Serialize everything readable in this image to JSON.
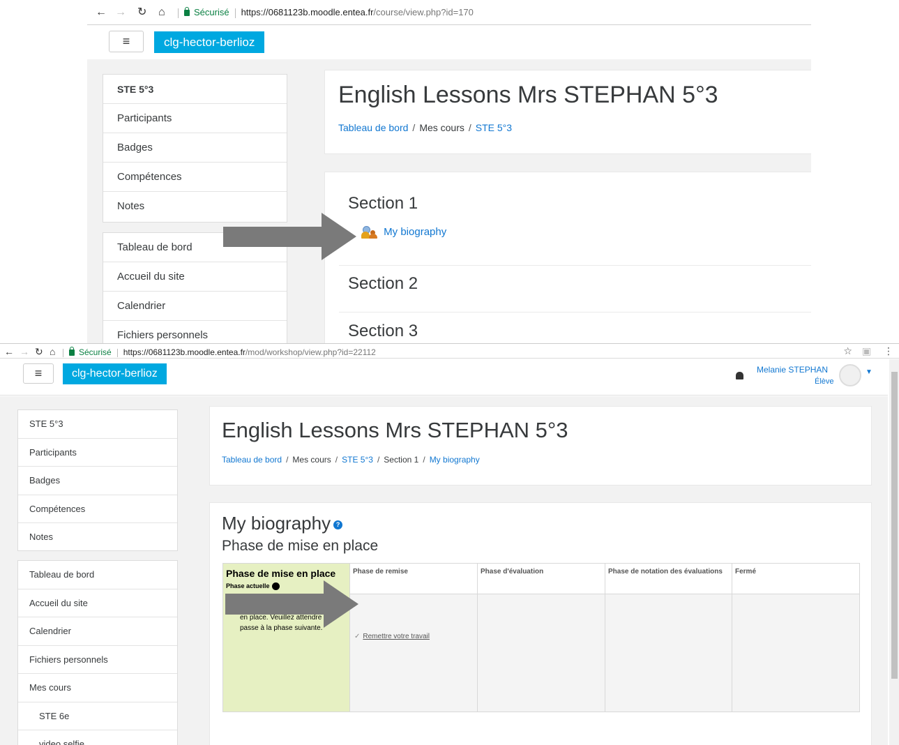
{
  "top": {
    "browser": {
      "secure_label": "Sécurisé",
      "url_host": "https://0681123b.moodle.entea.fr",
      "url_path": "/course/view.php?id=170"
    },
    "brand": "clg-hector-berlioz",
    "sidebar_block1": [
      "STE 5°3",
      "Participants",
      "Badges",
      "Compétences",
      "Notes"
    ],
    "sidebar_block2": [
      "Tableau de bord",
      "Accueil du site",
      "Calendrier",
      "Fichiers personnels"
    ],
    "course_title": "English Lessons Mrs STEPHAN 5°3",
    "breadcrumb": {
      "item1": "Tableau de bord",
      "item2": "Mes cours",
      "item3": "STE 5°3",
      "separator": "/"
    },
    "sections": {
      "s1": "Section 1",
      "activity": "My biography",
      "s2": "Section 2",
      "s3": "Section 3"
    }
  },
  "bottom": {
    "browser": {
      "secure_label": "Sécurisé",
      "url_host": "https://0681123b.moodle.entea.fr",
      "url_path": "/mod/workshop/view.php?id=22112"
    },
    "brand": "clg-hector-berlioz",
    "user": {
      "name": "Melanie STEPHAN",
      "role": "Élève"
    },
    "sidebar_block1": [
      "STE 5°3",
      "Participants",
      "Badges",
      "Compétences",
      "Notes"
    ],
    "sidebar_block2": [
      "Tableau de bord",
      "Accueil du site",
      "Calendrier",
      "Fichiers personnels",
      "Mes cours",
      "STE 6e",
      "video selfie"
    ],
    "course_title": "English Lessons Mrs STEPHAN 5°3",
    "breadcrumb": {
      "item1": "Tableau de bord",
      "item2": "Mes cours",
      "item3": "STE 5°3",
      "item4": "Section 1",
      "item5": "My biography",
      "separator": "/"
    },
    "workshop": {
      "title": "My biography",
      "help_icon": "?",
      "current_phase": "Phase de mise en place",
      "phases": [
        {
          "label": "Phase de mise en place",
          "active": true
        },
        {
          "label": "Phase de remise",
          "active": false
        },
        {
          "label": "Phase d'évaluation",
          "active": false
        },
        {
          "label": "Phase de notation des évaluations",
          "active": false
        },
        {
          "label": "Fermé",
          "active": false
        }
      ],
      "current_phase_label": "Phase actuelle",
      "note_text": "en place. Veuillez attendre qu'il passe à la phase suivante.",
      "task_link": "Remettre votre travail"
    }
  },
  "colors": {
    "brand_bg": "#00a8e0",
    "link": "#1177d1",
    "active_phase_bg": "#e6f0c2",
    "arrow": "#7a7a7a",
    "secure_green": "#0b8043"
  },
  "icons": [
    "back-arrow-icon",
    "forward-arrow-icon",
    "reload-icon",
    "home-icon",
    "lock-icon",
    "hamburger-icon",
    "workshop-icon",
    "bell-icon",
    "avatar-icon",
    "help-icon",
    "star-icon",
    "task-icon"
  ]
}
